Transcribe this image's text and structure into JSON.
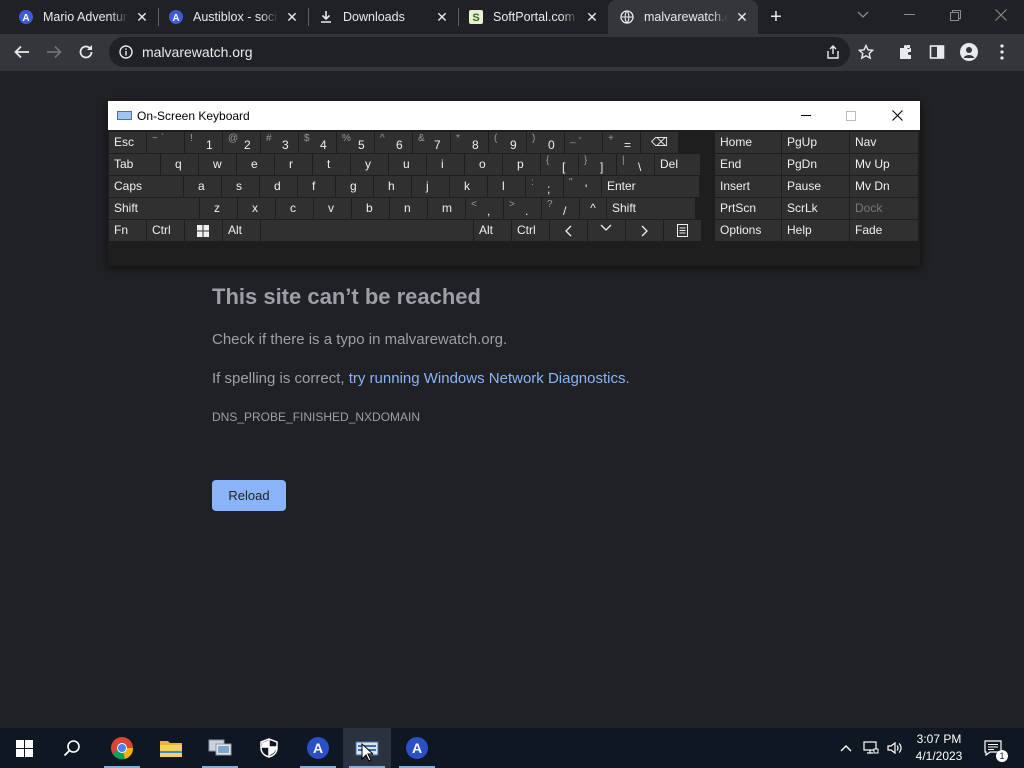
{
  "browser": {
    "tabs": [
      {
        "title": "Mario Adventures",
        "icon": "a-icon",
        "active": false
      },
      {
        "title": "Austiblox - social",
        "icon": "a-icon",
        "active": false
      },
      {
        "title": "Downloads",
        "icon": "download-icon",
        "active": false
      },
      {
        "title": "SoftPortal.com",
        "icon": "softportal-icon",
        "active": false
      },
      {
        "title": "malvarewatch.org",
        "icon": "globe-icon",
        "active": true
      }
    ],
    "address": "malvarewatch.org"
  },
  "error_page": {
    "title": "This site can’t be reached",
    "line1": "Check if there is a typo in malvarewatch.org.",
    "line2_prefix": "If spelling is correct, ",
    "line2_link": "try running Windows Network Diagnostics",
    "line2_suffix": ".",
    "code": "DNS_PROBE_FINISHED_NXDOMAIN",
    "reload_label": "Reload"
  },
  "osk": {
    "title": "On-Screen Keyboard",
    "row1": [
      {
        "type": "lbl",
        "text": "Esc"
      },
      {
        "type": "pair",
        "sub": "~ `",
        "main": ""
      },
      {
        "type": "pair",
        "sub": "!",
        "main": "1"
      },
      {
        "type": "pair",
        "sub": "@",
        "main": "2"
      },
      {
        "type": "pair",
        "sub": "#",
        "main": "3"
      },
      {
        "type": "pair",
        "sub": "$",
        "main": "4"
      },
      {
        "type": "pair",
        "sub": "%",
        "main": "5"
      },
      {
        "type": "pair",
        "sub": "^",
        "main": "6"
      },
      {
        "type": "pair",
        "sub": "&",
        "main": "7"
      },
      {
        "type": "pair",
        "sub": "*",
        "main": "8"
      },
      {
        "type": "pair",
        "sub": "(",
        "main": "9"
      },
      {
        "type": "pair",
        "sub": ")",
        "main": "0"
      },
      {
        "type": "pair",
        "sub": "_ -",
        "main": ""
      },
      {
        "type": "pair",
        "sub": "+",
        "main": "="
      },
      {
        "type": "icon",
        "text": "⌫"
      }
    ],
    "row2": [
      "Tab",
      "q",
      "w",
      "e",
      "r",
      "t",
      "y",
      "u",
      "i",
      "o",
      "p",
      "{ [",
      "} ]",
      "| \\",
      "Del"
    ],
    "row3": [
      "Caps",
      "a",
      "s",
      "d",
      "f",
      "g",
      "h",
      "j",
      "k",
      "l",
      ": ;",
      "\" '",
      "Enter"
    ],
    "row4": [
      "Shift",
      "z",
      "x",
      "c",
      "v",
      "b",
      "n",
      "m",
      "< ,",
      "> .",
      "? /",
      "^",
      "Shift"
    ],
    "row5": [
      "Fn",
      "Ctrl",
      "Win",
      "Alt",
      "",
      "Alt",
      "Ctrl",
      "<",
      "v",
      ">",
      "menu"
    ],
    "nav": [
      [
        "Home",
        "PgUp",
        "Nav"
      ],
      [
        "End",
        "PgDn",
        "Mv Up"
      ],
      [
        "Insert",
        "Pause",
        "Mv Dn"
      ],
      [
        "PrtScn",
        "ScrLk",
        "Dock"
      ],
      [
        "Options",
        "Help",
        "Fade"
      ]
    ]
  },
  "taskbar": {
    "apps": [
      "chrome-icon",
      "file-explorer-icon",
      "network-app-icon",
      "security-icon",
      "a-app-icon",
      "on-screen-keyboard-icon",
      "a-app-icon"
    ],
    "time": "3:07 PM",
    "date": "4/1/2023",
    "notification_count": "1"
  },
  "colors": {
    "bg": "#202124",
    "toolbar": "#35363a",
    "link": "#8ab4f8",
    "taskbar": "#0f1722"
  }
}
